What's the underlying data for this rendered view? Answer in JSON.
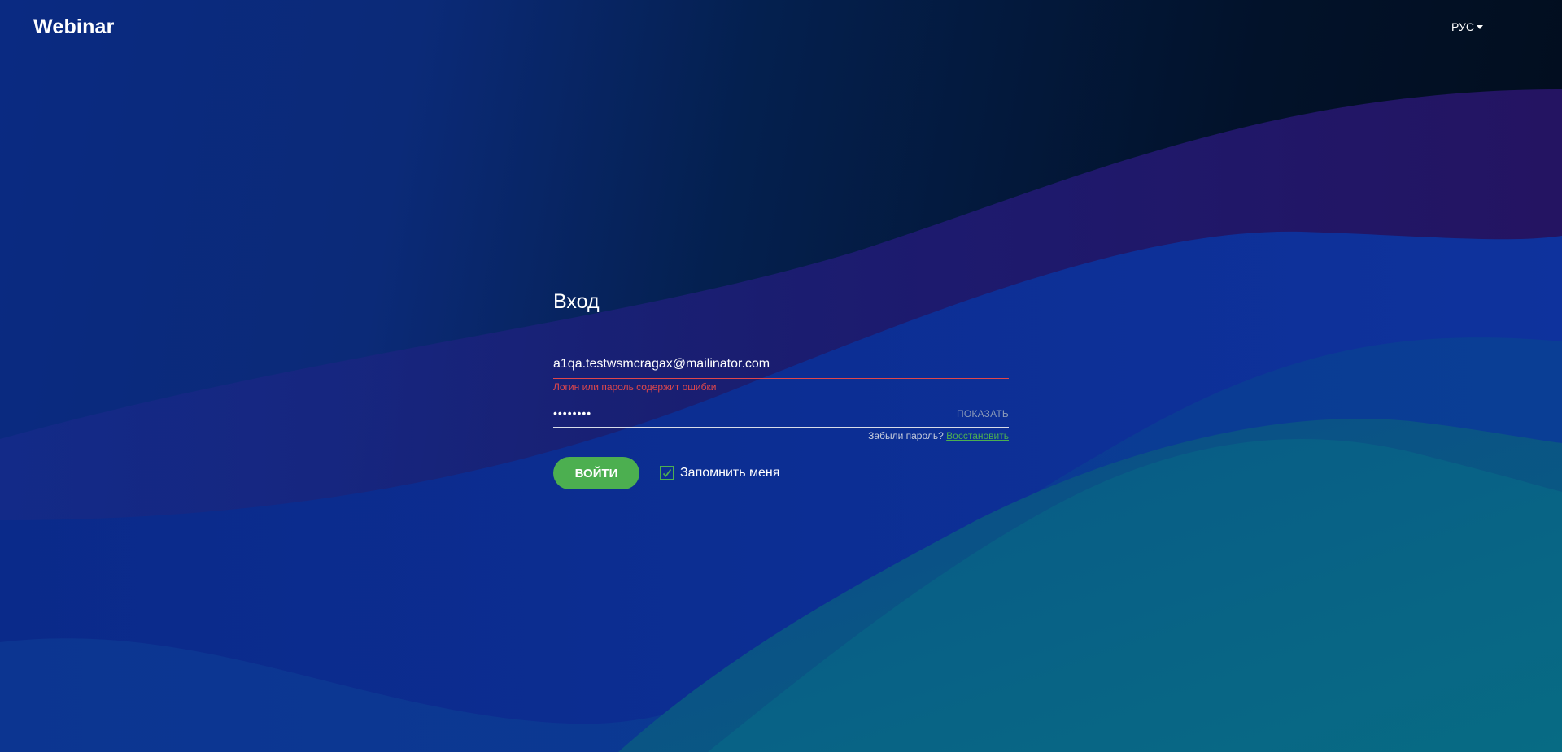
{
  "header": {
    "logo": "Webinar",
    "language": "РУС"
  },
  "login": {
    "title": "Вход",
    "email_value": "a1qa.testwsmcragax@mailinator.com",
    "error_text": "Логин или пароль содержит ошибки",
    "password_value": "••••••••",
    "show_label": "ПОКАЗАТЬ",
    "forgot_text": "Забыли пароль?",
    "restore_link": "Восстановить",
    "submit_label": "ВОЙТИ",
    "remember_label": "Запомнить меня",
    "remember_checked": true
  },
  "colors": {
    "accent": "#4caf50",
    "error": "#e0474b"
  }
}
